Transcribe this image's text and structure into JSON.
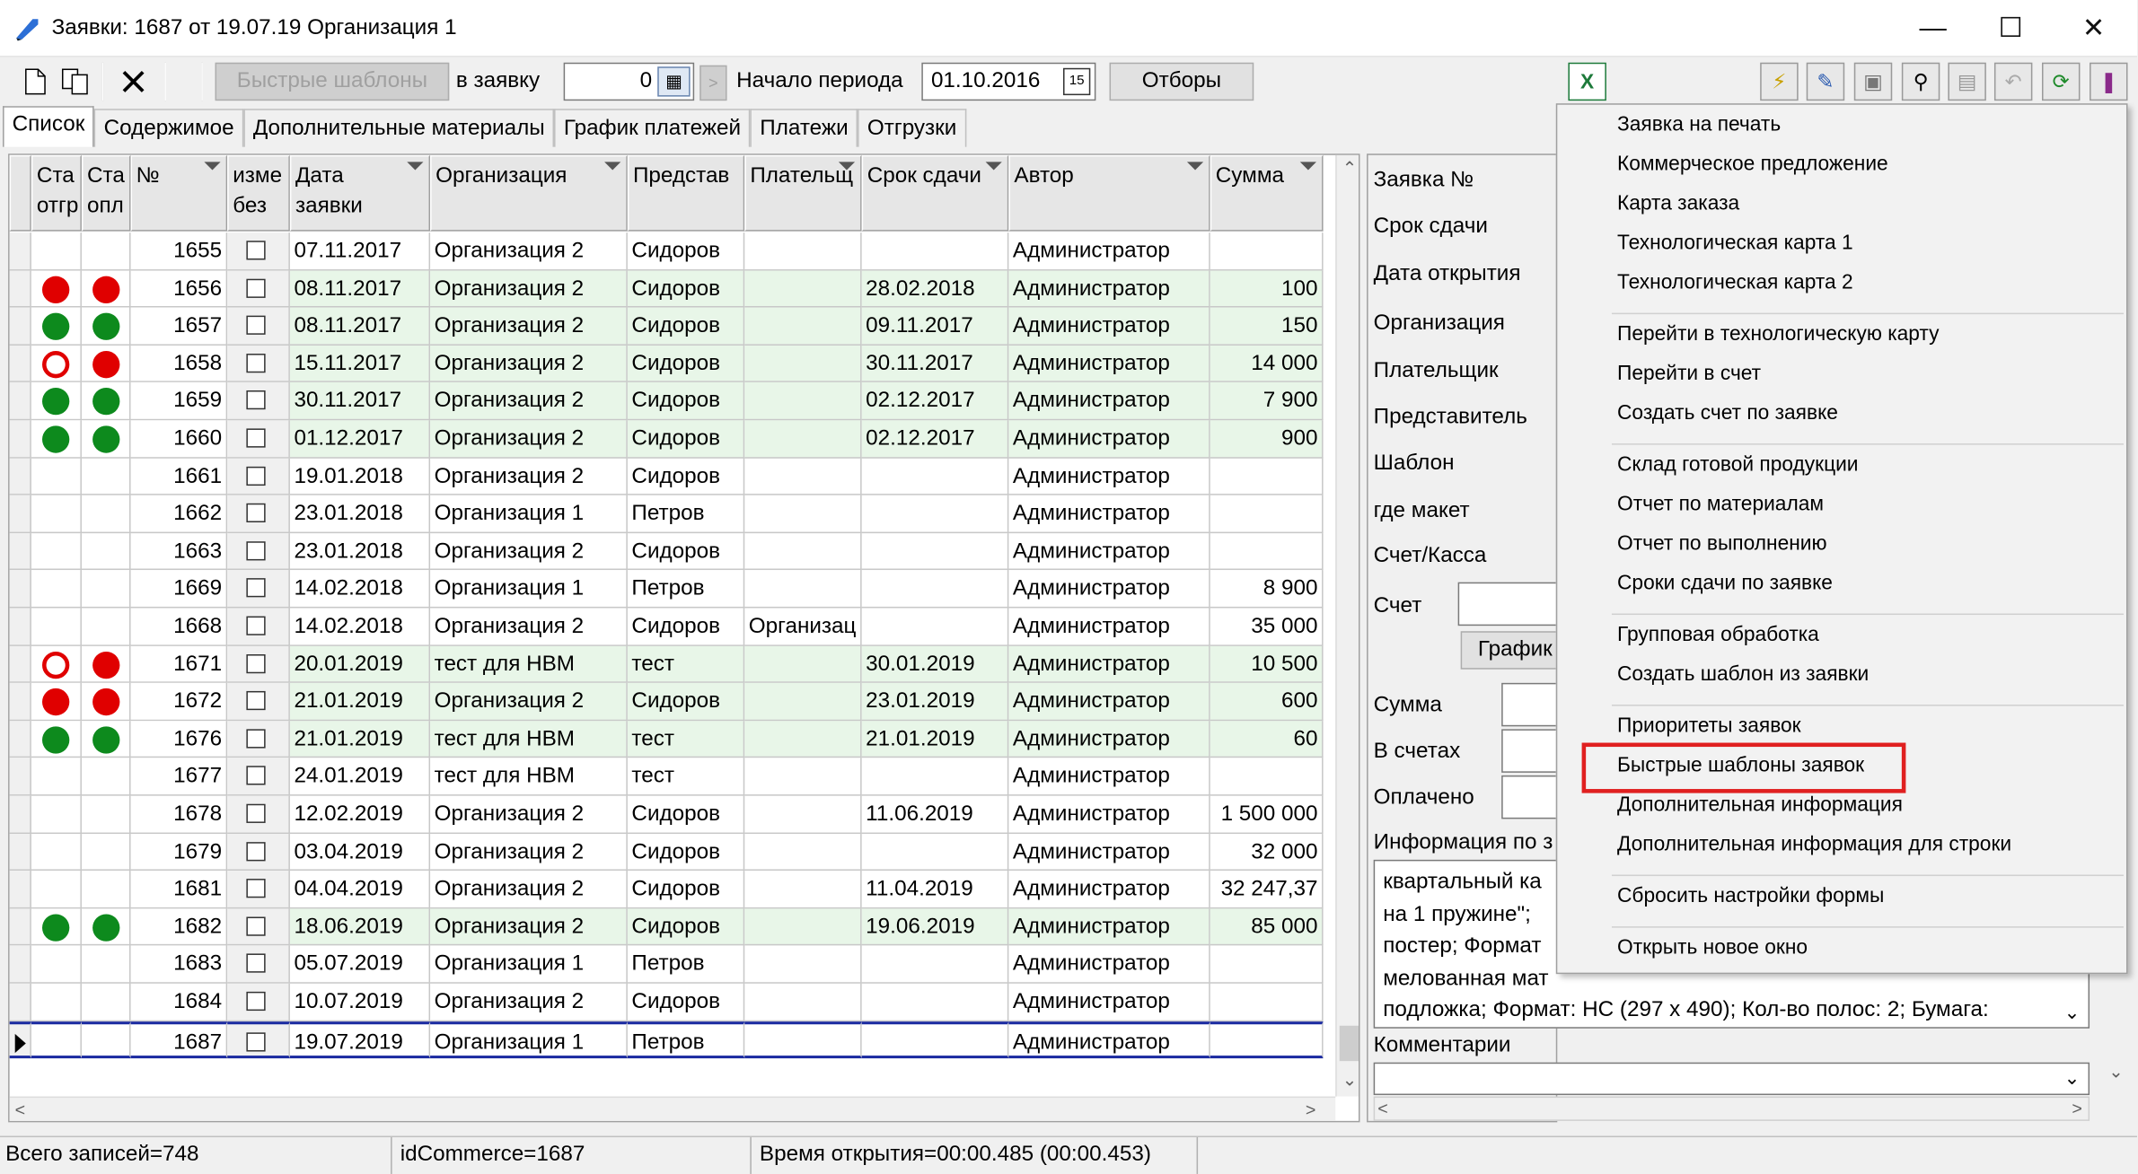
{
  "window": {
    "title": "Заявки: 1687 от 19.07.19  Организация 1",
    "controls": [
      "—",
      "☐",
      "✕"
    ]
  },
  "toolbar": {
    "quick_templates": "Быстрые шаблоны",
    "to_request": "в заявку",
    "count_value": "0",
    "period_label": "Начало периода",
    "period_value": "01.10.2016",
    "filters": "Отборы"
  },
  "tabs": [
    "Список",
    "Содержимое",
    "Дополнительные материалы",
    "График платежей",
    "Платежи",
    "Отгрузки"
  ],
  "grid": {
    "columns": [
      "",
      "Ста\nотгр",
      "Ста\nопл",
      "№",
      "изме\nбез",
      "Дата\nзаявки",
      "Организация",
      "Представ",
      "Плательщ",
      "Срок сдачи",
      "Автор",
      "Сумма"
    ],
    "rows": [
      {
        "s1": "",
        "s2": "",
        "num": "1655",
        "date": "07.11.2017",
        "org": "Организация 2",
        "rep": "Сидоров",
        "payer": "",
        "due": "",
        "author": "Администратор",
        "sum": "",
        "green": false
      },
      {
        "s1": "red",
        "s2": "red",
        "num": "1656",
        "date": "08.11.2017",
        "org": "Организация 2",
        "rep": "Сидоров",
        "payer": "",
        "due": "28.02.2018",
        "author": "Администратор",
        "sum": "100",
        "green": true
      },
      {
        "s1": "green",
        "s2": "green",
        "num": "1657",
        "date": "08.11.2017",
        "org": "Организация 2",
        "rep": "Сидоров",
        "payer": "",
        "due": "09.11.2017",
        "author": "Администратор",
        "sum": "150",
        "green": true
      },
      {
        "s1": "ring",
        "s2": "red",
        "num": "1658",
        "date": "15.11.2017",
        "org": "Организация 2",
        "rep": "Сидоров",
        "payer": "",
        "due": "30.11.2017",
        "author": "Администратор",
        "sum": "14 000",
        "green": true
      },
      {
        "s1": "green",
        "s2": "green",
        "num": "1659",
        "date": "30.11.2017",
        "org": "Организация 2",
        "rep": "Сидоров",
        "payer": "",
        "due": "02.12.2017",
        "author": "Администратор",
        "sum": "7 900",
        "green": true
      },
      {
        "s1": "green",
        "s2": "green",
        "num": "1660",
        "date": "01.12.2017",
        "org": "Организация 2",
        "rep": "Сидоров",
        "payer": "",
        "due": "02.12.2017",
        "author": "Администратор",
        "sum": "900",
        "green": true
      },
      {
        "s1": "",
        "s2": "",
        "num": "1661",
        "date": "19.01.2018",
        "org": "Организация 2",
        "rep": "Сидоров",
        "payer": "",
        "due": "",
        "author": "Администратор",
        "sum": "",
        "green": false
      },
      {
        "s1": "",
        "s2": "",
        "num": "1662",
        "date": "23.01.2018",
        "org": "Организация 1",
        "rep": "Петров",
        "payer": "",
        "due": "",
        "author": "Администратор",
        "sum": "",
        "green": false
      },
      {
        "s1": "",
        "s2": "",
        "num": "1663",
        "date": "23.01.2018",
        "org": "Организация 2",
        "rep": "Сидоров",
        "payer": "",
        "due": "",
        "author": "Администратор",
        "sum": "",
        "green": false
      },
      {
        "s1": "",
        "s2": "",
        "num": "1669",
        "date": "14.02.2018",
        "org": "Организация 1",
        "rep": "Петров",
        "payer": "",
        "due": "",
        "author": "Администратор",
        "sum": "8 900",
        "green": false
      },
      {
        "s1": "",
        "s2": "",
        "num": "1668",
        "date": "14.02.2018",
        "org": "Организация 2",
        "rep": "Сидоров",
        "payer": "Организац",
        "due": "",
        "author": "Администратор",
        "sum": "35 000",
        "green": false
      },
      {
        "s1": "ring",
        "s2": "red",
        "num": "1671",
        "date": "20.01.2019",
        "org": "тест для НВМ",
        "rep": "тест",
        "payer": "",
        "due": "30.01.2019",
        "author": "Администратор",
        "sum": "10 500",
        "green": true
      },
      {
        "s1": "red",
        "s2": "red",
        "num": "1672",
        "date": "21.01.2019",
        "org": "Организация 2",
        "rep": "Сидоров",
        "payer": "",
        "due": "23.01.2019",
        "author": "Администратор",
        "sum": "600",
        "green": true
      },
      {
        "s1": "green",
        "s2": "green",
        "num": "1676",
        "date": "21.01.2019",
        "org": "тест для НВМ",
        "rep": "тест",
        "payer": "",
        "due": "21.01.2019",
        "author": "Администратор",
        "sum": "60",
        "green": true
      },
      {
        "s1": "",
        "s2": "",
        "num": "1677",
        "date": "24.01.2019",
        "org": "тест для НВМ",
        "rep": "тест",
        "payer": "",
        "due": "",
        "author": "Администратор",
        "sum": "",
        "green": false
      },
      {
        "s1": "",
        "s2": "",
        "num": "1678",
        "date": "12.02.2019",
        "org": "Организация 2",
        "rep": "Сидоров",
        "payer": "",
        "due": "11.06.2019",
        "author": "Администратор",
        "sum": "1 500 000",
        "green": false
      },
      {
        "s1": "",
        "s2": "",
        "num": "1679",
        "date": "03.04.2019",
        "org": "Организация 2",
        "rep": "Сидоров",
        "payer": "",
        "due": "",
        "author": "Администратор",
        "sum": "32 000",
        "green": false
      },
      {
        "s1": "",
        "s2": "",
        "num": "1681",
        "date": "04.04.2019",
        "org": "Организация 2",
        "rep": "Сидоров",
        "payer": "",
        "due": "11.04.2019",
        "author": "Администратор",
        "sum": "32 247,37",
        "green": false
      },
      {
        "s1": "green",
        "s2": "green",
        "num": "1682",
        "date": "18.06.2019",
        "org": "Организация 2",
        "rep": "Сидоров",
        "payer": "",
        "due": "19.06.2019",
        "author": "Администратор",
        "sum": "85 000",
        "green": true
      },
      {
        "s1": "",
        "s2": "",
        "num": "1683",
        "date": "05.07.2019",
        "org": "Организация 1",
        "rep": "Петров",
        "payer": "",
        "due": "",
        "author": "Администратор",
        "sum": "",
        "green": false
      },
      {
        "s1": "",
        "s2": "",
        "num": "1684",
        "date": "10.07.2019",
        "org": "Организация 2",
        "rep": "Сидоров",
        "payer": "",
        "due": "",
        "author": "Администратор",
        "sum": "",
        "green": false
      },
      {
        "s1": "",
        "s2": "",
        "num": "1687",
        "date": "19.07.2019",
        "org": "Организация 1",
        "rep": "Петров",
        "payer": "",
        "due": "",
        "author": "Администратор",
        "sum": "",
        "green": false,
        "current": true
      }
    ]
  },
  "panel": {
    "labels": [
      "Заявка №",
      "Срок сдачи",
      "Дата открытия",
      "Организация",
      "Плательщик",
      "Представитель",
      "Шаблон",
      "где макет",
      "Счет/Касса",
      "Счет"
    ],
    "schedule_button": "График",
    "sum_labels": [
      "Сумма",
      "В счетах",
      "Оплачено"
    ],
    "info_label": "Информация по з",
    "info_lines": [
      "квартальный ка",
      "на 1 пружине\"; ",
      "постер; Формат",
      "мелованная мат",
      "подложка; Формат: НС (297 х 490); Кол-во полос: 2;  Бумага:"
    ],
    "comments_label": "Комментарии"
  },
  "menu": {
    "groups": [
      [
        "Заявка на печать",
        "Коммерческое предложение",
        "Карта заказа",
        "Технологическая карта 1",
        "Технологическая карта 2"
      ],
      [
        "Перейти в технологическую карту",
        "Перейти в счет",
        "Создать счет по заявке"
      ],
      [
        "Склад готовой продукции",
        "Отчет по материалам",
        "Отчет по выполнению",
        "Сроки сдачи по заявке"
      ],
      [
        "Групповая обработка",
        "Создать шаблон из заявки"
      ],
      [
        "Приоритеты заявок",
        "Быстрые шаблоны заявок",
        "Дополнительная информация",
        "Дополнительная информация для строки"
      ],
      [
        "Сбросить настройки формы"
      ],
      [
        "Открыть новое окно"
      ]
    ],
    "highlighted": "Быстрые шаблоны заявок"
  },
  "status": {
    "records": "Всего записей=748",
    "id": "idCommerce=1687",
    "open_time": "Время открытия=00:00.485 (00:00.453)"
  },
  "colors": {
    "red": "#e00000",
    "green": "#0d8a1d",
    "row_tint": "#e8f6e8",
    "highlight": "#e02020"
  }
}
